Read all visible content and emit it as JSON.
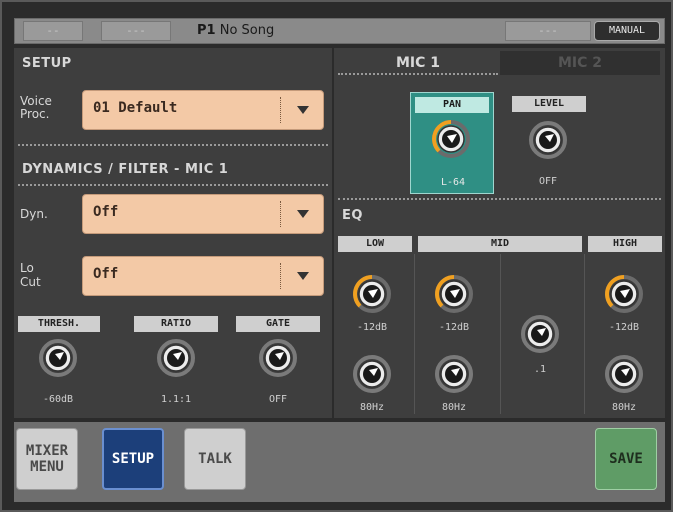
{
  "topbar": {
    "seg1": "--",
    "seg2": "---",
    "song_prefix": "P1",
    "song_name": "No Song",
    "seg3": "---",
    "manual_label": "MANUAL"
  },
  "setup": {
    "title": "SETUP",
    "voice_proc_label_1": "Voice",
    "voice_proc_label_2": "Proc.",
    "voice_proc_value": "01 Default"
  },
  "dynamics": {
    "title": "DYNAMICS / FILTER - MIC 1",
    "dyn_label": "Dyn.",
    "dyn_value": "Off",
    "locut_label_1": "Lo",
    "locut_label_2": "Cut",
    "locut_value": "Off",
    "knobs": [
      {
        "label": "THRESH.",
        "value": "-60dB"
      },
      {
        "label": "RATIO",
        "value": "1.1:1"
      },
      {
        "label": "GATE",
        "value": "OFF"
      }
    ]
  },
  "mic_tabs": {
    "mic1": "MIC 1",
    "mic2": "MIC 2"
  },
  "pan_level": {
    "pan_label": "PAN",
    "pan_value": "L-64",
    "level_label": "LEVEL",
    "level_value": "OFF"
  },
  "eq": {
    "title": "EQ",
    "bands": {
      "low": "LOW",
      "mid": "MID",
      "high": "HIGH"
    },
    "low_gain": "-12dB",
    "low_freq": "80Hz",
    "mid_gain": "-12dB",
    "mid_freq": "80Hz",
    "mid_q": ".1",
    "high_gain": "-12dB",
    "high_freq": "80Hz"
  },
  "bottom": {
    "mixer_menu": "MIXER MENU",
    "setup": "SETUP",
    "talk": "TALK",
    "save": "SAVE"
  },
  "colors": {
    "accent_orange": "#f0a020",
    "dropdown": "#f3c9a6",
    "pan_teal": "#2f8f84",
    "setup_active": "#1c3f7a",
    "save_green": "#5f9c66"
  }
}
